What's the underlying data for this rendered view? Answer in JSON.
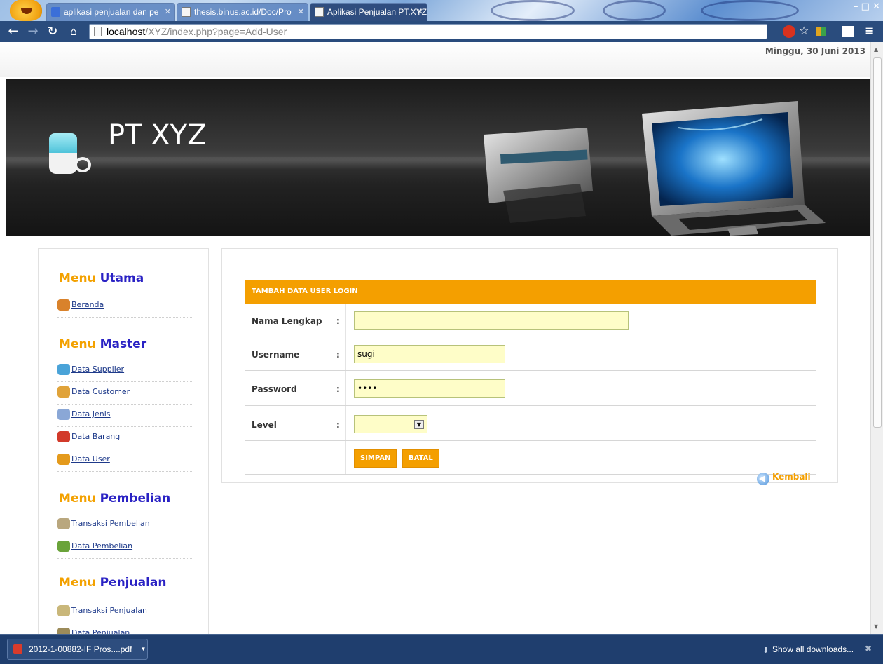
{
  "browser": {
    "tabs": [
      {
        "title": "aplikasi penjualan dan pe",
        "favicon": "google-icon"
      },
      {
        "title": "thesis.binus.ac.id/Doc/Pro",
        "favicon": "page-icon"
      },
      {
        "title": "Aplikasi Penjualan PT.XYZ",
        "favicon": "page-icon"
      }
    ],
    "address": {
      "host": "localhost",
      "path": "/XYZ/index.php?page=Add-User"
    },
    "extensions": [
      "adblock-icon",
      "bookmark-star-icon",
      "extension-icon",
      "page-action-icon",
      "chrome-menu-icon"
    ]
  },
  "page": {
    "date": "Minggu, 30 Juni 2013",
    "banner": {
      "brand": "PT XYZ"
    }
  },
  "sidebar": {
    "sections": [
      {
        "w1": "Menu",
        "w2": "Utama",
        "items": [
          {
            "label": "Beranda",
            "icon": "home-icon",
            "color": "#d9822b"
          }
        ]
      },
      {
        "w1": "Menu",
        "w2": "Master",
        "items": [
          {
            "label": "Data Supplier",
            "icon": "supplier-icon",
            "color": "#4aa3d8"
          },
          {
            "label": "Data Customer",
            "icon": "customer-icon",
            "color": "#e0a33a"
          },
          {
            "label": "Data Jenis",
            "icon": "category-icon",
            "color": "#8aa7d6"
          },
          {
            "label": "Data Barang",
            "icon": "goods-icon",
            "color": "#d23a2a"
          },
          {
            "label": "Data User",
            "icon": "users-icon",
            "color": "#e49a1c"
          }
        ]
      },
      {
        "w1": "Menu",
        "w2": "Pembelian",
        "items": [
          {
            "label": "Transaksi Pembelian",
            "icon": "purchase-transaction-icon",
            "color": "#b9a77e"
          },
          {
            "label": "Data Pembelian",
            "icon": "purchase-data-icon",
            "color": "#6aa33a"
          }
        ]
      },
      {
        "w1": "Menu",
        "w2": "Penjualan",
        "items": [
          {
            "label": "Transaksi Penjualan",
            "icon": "sales-transaction-icon",
            "color": "#c9b77a"
          },
          {
            "label": "Data Penjualan",
            "icon": "sales-data-icon",
            "color": "#9c8b5a"
          }
        ]
      }
    ]
  },
  "form": {
    "title": "TAMBAH DATA USER LOGIN",
    "fields": [
      {
        "label": "Nama Lengkap",
        "colon": ":",
        "value": "",
        "type": "text"
      },
      {
        "label": "Username",
        "colon": ":",
        "value": "sugi",
        "type": "text"
      },
      {
        "label": "Password",
        "colon": ":",
        "value": "••••",
        "type": "password"
      },
      {
        "label": "Level",
        "colon": ":",
        "value": "",
        "type": "select"
      }
    ],
    "buttons": {
      "save": "SIMPAN",
      "cancel": "BATAL"
    },
    "back": "Kembali"
  },
  "downloads": {
    "file": "2012-1-00882-IF Pros....pdf",
    "show_all": "Show all downloads..."
  },
  "colors": {
    "accent": "#f49f00",
    "heading_blue": "#2a22c4",
    "toolbar": "#2a4c7d"
  }
}
